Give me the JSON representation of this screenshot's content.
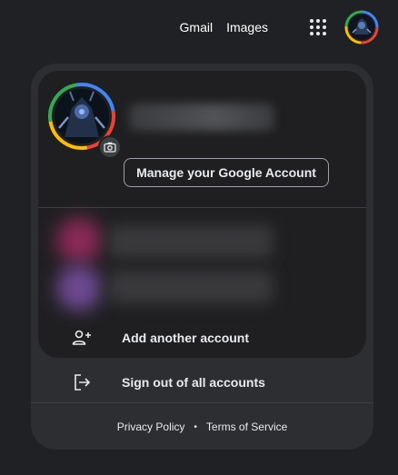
{
  "topbar": {
    "gmail_label": "Gmail",
    "images_label": "Images",
    "apps_icon": "apps-grid-icon",
    "avatar_icon": "account-avatar-icon"
  },
  "account_panel": {
    "avatar_icon": "profile-avatar-icon",
    "camera_icon": "camera-icon",
    "manage_account_label": "Manage your Google Account",
    "add_account": {
      "label": "Add another account",
      "icon": "person-add-icon"
    },
    "sign_out": {
      "label": "Sign out of all accounts",
      "icon": "logout-icon"
    },
    "footer": {
      "privacy_label": "Privacy Policy",
      "separator": "•",
      "terms_label": "Terms of Service"
    }
  },
  "colors": {
    "background": "#202124",
    "panel": "#2d2e31",
    "inner_panel": "#1f1f21",
    "google_ring": [
      "#4285f4",
      "#ea4335",
      "#fbbc05",
      "#34a853"
    ]
  }
}
